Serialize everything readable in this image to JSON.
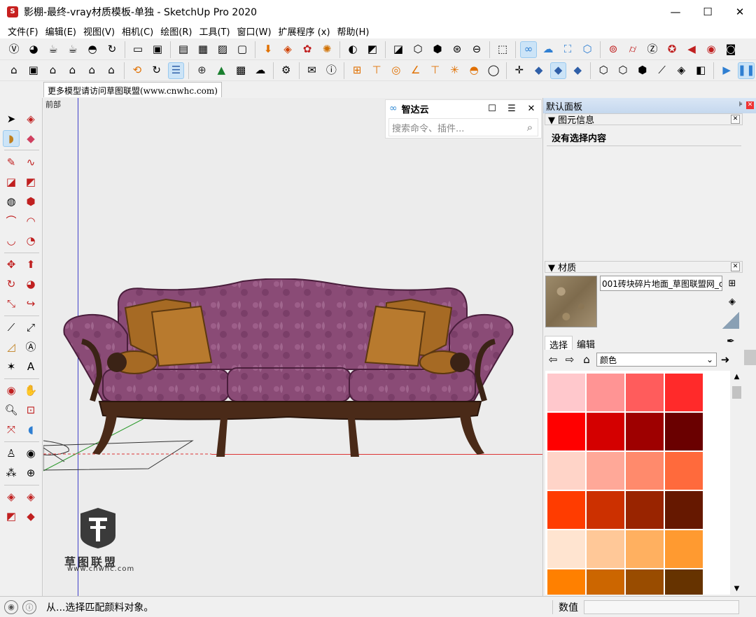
{
  "window": {
    "title": "影棚-最终-vray材质模板-单独 - SketchUp Pro 2020",
    "minimize": "—",
    "maximize": "☐",
    "close": "✕"
  },
  "menu": [
    "文件(F)",
    "编辑(E)",
    "视图(V)",
    "相机(C)",
    "绘图(R)",
    "工具(T)",
    "窗口(W)",
    "扩展程序 (x)",
    "帮助(H)"
  ],
  "model_tab": "更多模型请访问草图联盟(www.cnwhc.com)",
  "viewport": {
    "scene_label": "前部",
    "watermark_text": "草图联盟",
    "watermark_url": "www.cnwhc.com"
  },
  "zhidayun": {
    "title": "智达云",
    "search_placeholder": "搜索命令、插件..."
  },
  "right_panel": {
    "title": "默认面板",
    "entity_info": {
      "header": "▼ 图元信息",
      "message": "没有选择内容"
    },
    "materials": {
      "header": "▼ 材质",
      "material_name": "001砖块碎片地面_草图联盟网_c",
      "tab_select": "选择",
      "tab_edit": "编辑",
      "library": "颜色"
    }
  },
  "status": {
    "text": "从...选择匹配颜料对象。",
    "measure_label": "数值"
  },
  "colors": {
    "swatches": [
      "#ffc8cc",
      "#ff9494",
      "#ff5c5c",
      "#ff2a2a",
      "#ff0000",
      "#d40000",
      "#9e0000",
      "#6a0000",
      "#ffd4c8",
      "#ffa898",
      "#ff8a6c",
      "#ff6a3c",
      "#ff3c00",
      "#cc3000",
      "#992400",
      "#661800",
      "#ffe4d0",
      "#ffc898",
      "#ffb060",
      "#ff9a30",
      "#ff8000",
      "#cc6600",
      "#994c00",
      "#663300"
    ]
  }
}
